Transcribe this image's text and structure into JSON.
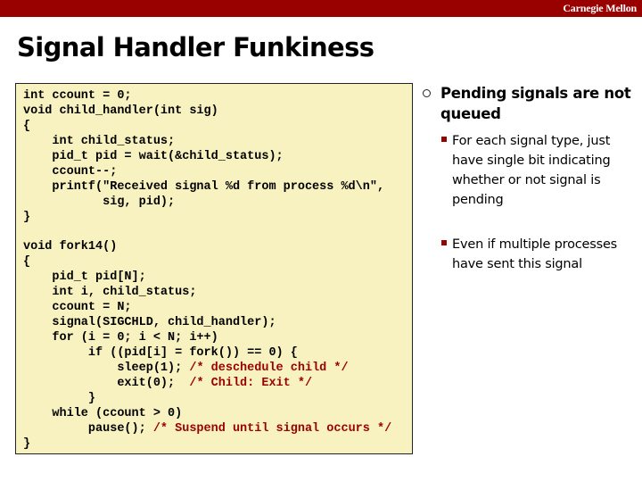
{
  "header": {
    "brand": "Carnegie Mellon",
    "bar_color": "#990000"
  },
  "slide": {
    "title": "Signal Handler Funkiness"
  },
  "code": {
    "background": "#f8f2c0",
    "comment_color": "#990000",
    "lines": [
      {
        "code": "int ccount = 0;",
        "comment": ""
      },
      {
        "code": "void child_handler(int sig)",
        "comment": ""
      },
      {
        "code": "{",
        "comment": ""
      },
      {
        "code": "    int child_status;",
        "comment": ""
      },
      {
        "code": "    pid_t pid = wait(&child_status);",
        "comment": ""
      },
      {
        "code": "    ccount--;",
        "comment": ""
      },
      {
        "code": "    printf(\"Received signal %d from process %d\\n\",",
        "comment": ""
      },
      {
        "code": "           sig, pid);",
        "comment": ""
      },
      {
        "code": "}",
        "comment": ""
      },
      {
        "code": "",
        "comment": ""
      },
      {
        "code": "void fork14()",
        "comment": ""
      },
      {
        "code": "{",
        "comment": ""
      },
      {
        "code": "    pid_t pid[N];",
        "comment": ""
      },
      {
        "code": "    int i, child_status;",
        "comment": ""
      },
      {
        "code": "    ccount = N;",
        "comment": ""
      },
      {
        "code": "    signal(SIGCHLD, child_handler);",
        "comment": ""
      },
      {
        "code": "    for (i = 0; i < N; i++)",
        "comment": ""
      },
      {
        "code": "         if ((pid[i] = fork()) == 0) {",
        "comment": ""
      },
      {
        "code": "             sleep(1); ",
        "comment": "/* deschedule child */"
      },
      {
        "code": "             exit(0);  ",
        "comment": "/* Child: Exit */"
      },
      {
        "code": "         }",
        "comment": ""
      },
      {
        "code": "    while (ccount > 0)",
        "comment": ""
      },
      {
        "code": "         pause(); ",
        "comment": "/* Suspend until signal occurs */"
      },
      {
        "code": "}",
        "comment": ""
      }
    ]
  },
  "bullets": {
    "main": "Pending signals are not queued",
    "sub": [
      "For each signal type, just have single bit indicating whether or not signal is pending",
      "Even if multiple processes have sent this signal"
    ]
  }
}
